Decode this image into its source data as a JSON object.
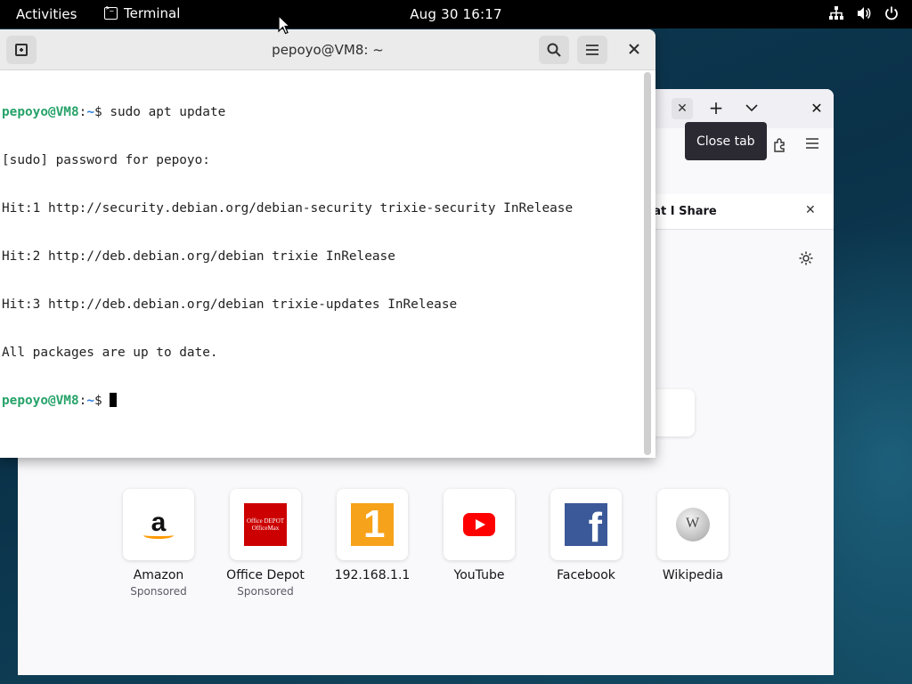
{
  "topbar": {
    "activities": "Activities",
    "app_name": "Terminal",
    "clock": "Aug 30  16:17",
    "status_icons": [
      "network-icon",
      "volume-icon",
      "power-icon"
    ]
  },
  "firefox": {
    "tooltip": "Close tab",
    "notice_text": "hat I Share",
    "shortcuts": [
      {
        "label": "Amazon",
        "sub": "Sponsored",
        "icon": "amazon-logo-icon"
      },
      {
        "label": "Office Depot",
        "sub": "Sponsored",
        "icon": "office-depot-logo-icon"
      },
      {
        "label": "192.168.1.1",
        "sub": "",
        "icon": "router-logo-icon"
      },
      {
        "label": "YouTube",
        "sub": "",
        "icon": "youtube-logo-icon"
      },
      {
        "label": "Facebook",
        "sub": "",
        "icon": "facebook-logo-icon"
      },
      {
        "label": "Wikipedia",
        "sub": "",
        "icon": "wikipedia-logo-icon"
      }
    ],
    "od_logo_line1": "Office DEPOT",
    "od_logo_line2": "OfficeMax"
  },
  "terminal": {
    "title": "pepoyo@VM8: ~",
    "prompt_user": "pepoyo@VM8",
    "prompt_sep": ":",
    "prompt_path": "~",
    "prompt_symbol": "$ ",
    "command1": "sudo apt update",
    "output": [
      "[sudo] password for pepoyo:",
      "Hit:1 http://security.debian.org/debian-security trixie-security InRelease",
      "Hit:2 http://deb.debian.org/debian trixie InRelease",
      "Hit:3 http://deb.debian.org/debian trixie-updates InRelease",
      "All packages are up to date."
    ]
  },
  "colors": {
    "prompt_user": "#26a269",
    "prompt_path": "#2a7bde",
    "topbar_bg": "#000000",
    "tooltip_bg": "#2b2a33"
  }
}
